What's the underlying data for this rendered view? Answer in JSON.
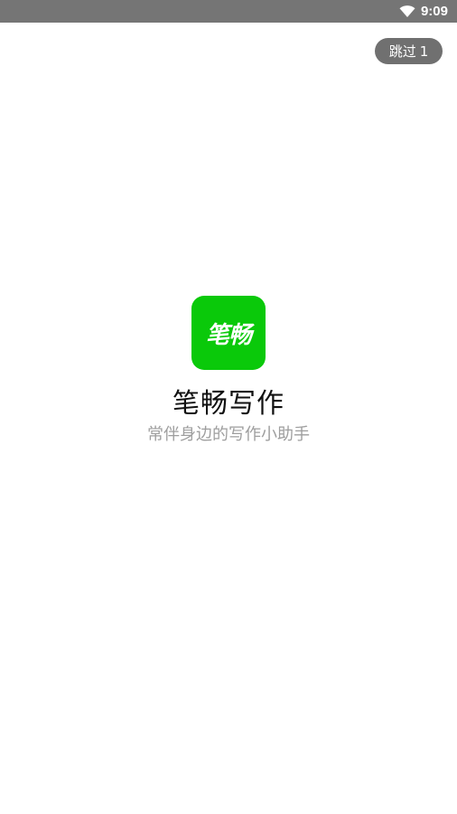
{
  "status_bar": {
    "time": "9:09",
    "wifi_icon": "wifi-icon"
  },
  "skip_button": {
    "label": "跳过",
    "count": "1"
  },
  "splash": {
    "logo_text": "笔畅",
    "app_name": "笔畅写作",
    "tagline": "常伴身边的写作小助手"
  },
  "colors": {
    "status_bar_bg": "#757575",
    "logo_bg": "#0ac90a",
    "skip_bg": "#707070",
    "tagline": "#9e9e9e"
  }
}
